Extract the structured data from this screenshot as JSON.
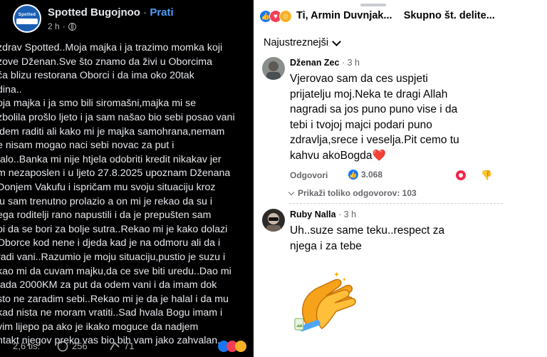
{
  "post": {
    "page_name": "Spotted Bugojnoo",
    "follow_label": "Prati",
    "time": "2 h",
    "avatar_text": "Spotted",
    "lines": [
      "zdrav Spotted..Moja majka i ja trazimo momka koji",
      "zove Dženan.Sve što znamo da živi u Oborcima",
      "ća blizu restorana Oborci i da ima oko 20tak",
      "dina..",
      "oja majka i ja smo bili siromašni,majka mi se",
      "zbolila prošlo ljeto i ja sam našao bio sebi posao vani",
      "idem raditi ali kako mi je majka samohrana,nemam",
      "e nisam mogao naci sebi novac za put i",
      "talo..Banka mi nije htjela odobriti kredit nikakav jer",
      "m nezaposlen i u ljeto 27.8.2025 upoznam Dženana",
      "Donjem Vakufu i ispričam mu svoju situaciju kroz",
      "ju sam trenutno prolazio a on mi je rekao da su i",
      "ega roditelji rano napustili i da je prepušten sam",
      "bi da se bori za bolje sutra..Rekao mi je kako dolazi",
      "Oborce kod nene i djeda kad je na odmoru ali da i",
      "radi vani..Razumio je moju situaciju,pustio je suzu i",
      "kao mi da cuvam majku,da ce sve biti uredu..Dao mi",
      "tada 2000KM za put da odem vani i da imam dok",
      "sto ne zaradim sebi..Rekao mi je da je halal i da mu",
      "kad nista ne moram vratiti..Sad hvala Bogu imam i",
      "vim lijepo pa ako je ikako moguce da nadjem",
      "ntakt njegov preko vas bio bih vam jako zahvalan."
    ],
    "reactions_count": "2,6 tis.",
    "comments_count": "256",
    "shares_count": "71"
  },
  "comments_panel": {
    "reacted_by": "Ti, Armin Duvnjak...",
    "share_label": "Skupno št. delite...",
    "sort_label": "Najustreznejši",
    "comments": [
      {
        "author": "Dženan Zec",
        "time": "3 h",
        "lines": [
          "Vjerovao sam da ces uspjeti",
          "prijatelju moj.Neka te dragi Allah",
          "nagradi sa jos puno puno vise i da",
          "tebi i tvojoj majci podari puno",
          "zdravlja,srece i veselja.Pit cemo tu",
          "kahvu akoBogda"
        ],
        "heart": "❤️",
        "reply_label": "Odgovori",
        "likes": "3.068",
        "more_replies": "Prikaži toliko odgovorov: 103"
      },
      {
        "author": "Ruby Nalla",
        "time": "3 h",
        "lines": [
          "Uh..suze same teku..respect za",
          "njega i za tebe"
        ]
      }
    ]
  },
  "colors": {
    "fb_blue": "#1877f2",
    "love_red": "#e41e3f",
    "dark_bg": "#000000",
    "dark_text": "#e4e6eb"
  }
}
